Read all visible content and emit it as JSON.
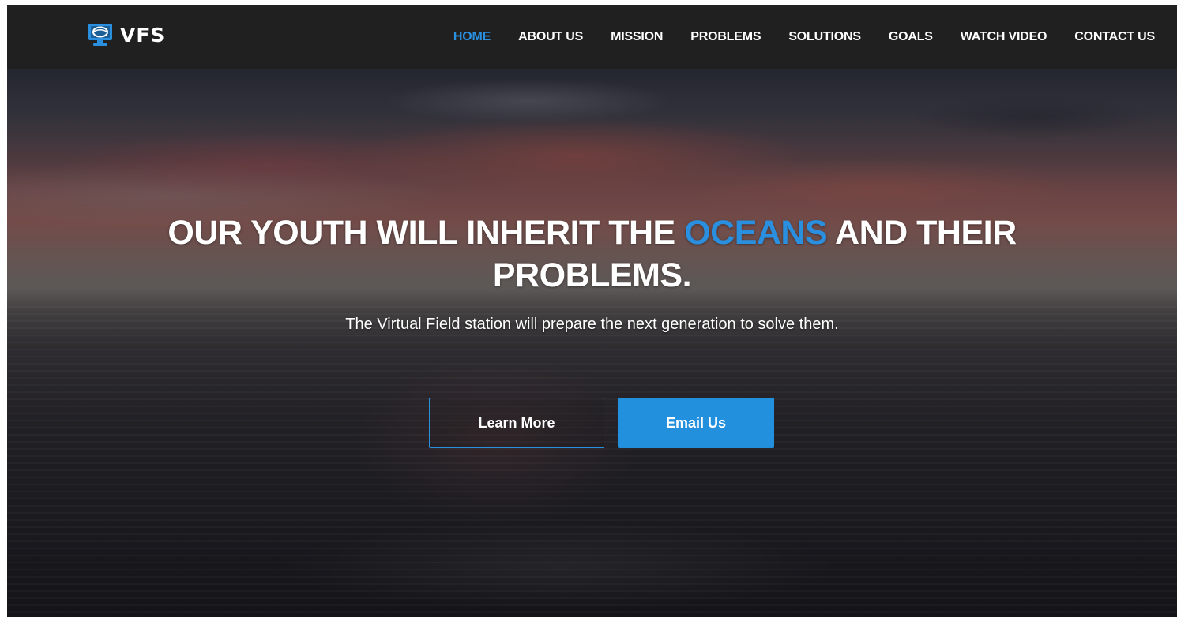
{
  "brand": {
    "name": "VFS",
    "icon": "monitor-globe-icon",
    "accent_color": "#2b8fe0"
  },
  "nav": {
    "items": [
      {
        "label": "HOME",
        "active": true
      },
      {
        "label": "ABOUT US",
        "active": false
      },
      {
        "label": "MISSION",
        "active": false
      },
      {
        "label": "PROBLEMS",
        "active": false
      },
      {
        "label": "SOLUTIONS",
        "active": false
      },
      {
        "label": "GOALS",
        "active": false
      },
      {
        "label": "WATCH VIDEO",
        "active": false
      },
      {
        "label": "CONTACT US",
        "active": false
      }
    ]
  },
  "hero": {
    "headline_part1": "OUR YOUTH WILL INHERIT THE",
    "headline_highlight": "OCEANS",
    "headline_part2": "AND THEIR",
    "headline_line2": "PROBLEMS.",
    "subtitle": "The Virtual Field station will prepare the next generation to solve them.",
    "buttons": {
      "learn_more": "Learn More",
      "email_us": "Email Us"
    }
  },
  "colors": {
    "navbar_bg": "#202020",
    "accent": "#2b8fe0",
    "button_solid": "#2390dd",
    "text": "#ffffff"
  }
}
